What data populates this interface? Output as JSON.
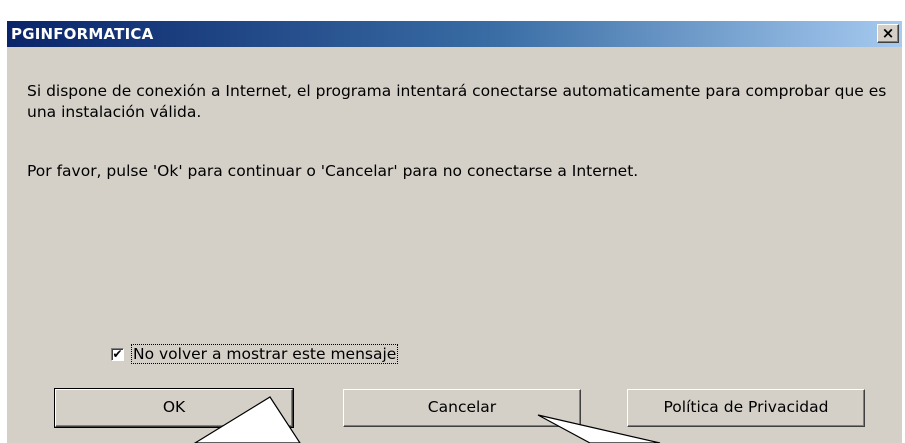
{
  "window": {
    "title": "PGINFORMATICA",
    "close_label": "×"
  },
  "message": {
    "paragraph1": "Si dispone de conexión a Internet, el programa intentará conectarse automaticamente para comprobar que es una instalación válida.",
    "paragraph2": "Por favor, pulse 'Ok' para continuar o 'Cancelar' para no conectarse a Internet."
  },
  "checkbox": {
    "label": "No volver a mostrar este mensaje",
    "checked": true,
    "check_glyph": "✔"
  },
  "buttons": {
    "ok": "OK",
    "cancel": "Cancelar",
    "privacy": "Política de Privacidad"
  }
}
